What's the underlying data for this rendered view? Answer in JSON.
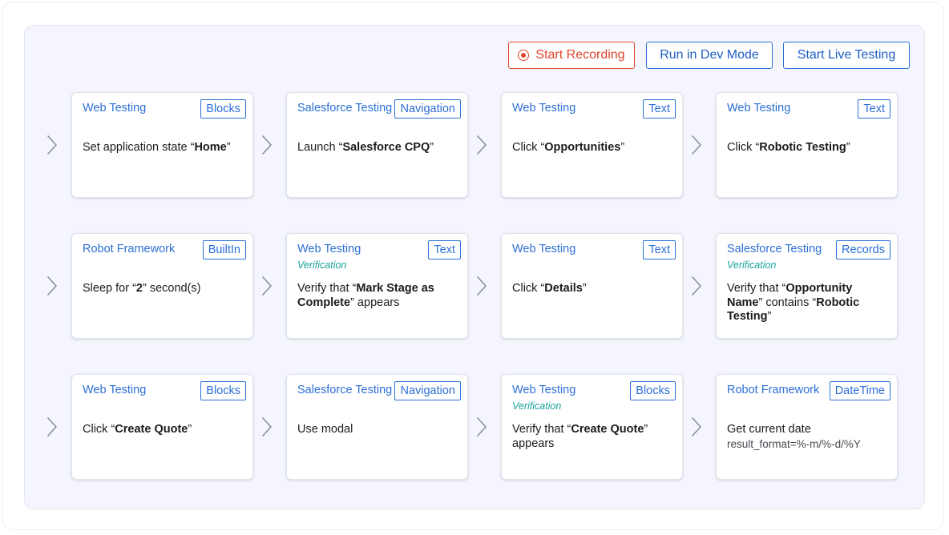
{
  "toolbar": {
    "start_recording": "Start Recording",
    "run_dev_mode": "Run in Dev Mode",
    "start_live_testing": "Start Live Testing"
  },
  "colors": {
    "accent_blue": "#2c6fd6",
    "record_red": "#e0452c",
    "verification_teal": "#1aa39a",
    "panel_bg": "#f5f6fd"
  },
  "icons": [
    "record-icon",
    "chevron-right-icon"
  ],
  "cards": [
    {
      "library": "Web Testing",
      "badge": "Blocks",
      "verification": "",
      "text_pre": "Set application state “",
      "text_bold": "Home",
      "text_post": "”",
      "param": ""
    },
    {
      "library": "Salesforce Testing",
      "badge": "Navigation",
      "verification": "",
      "text_pre": "Launch “",
      "text_bold": "Salesforce CPQ",
      "text_post": "”",
      "param": ""
    },
    {
      "library": "Web Testing",
      "badge": "Text",
      "verification": "",
      "text_pre": "Click “",
      "text_bold": "Opportunities",
      "text_post": "”",
      "param": ""
    },
    {
      "library": "Web Testing",
      "badge": "Text",
      "verification": "",
      "text_pre": "Click “",
      "text_bold": "Robotic Testing",
      "text_post": "”",
      "param": ""
    },
    {
      "library": "Robot Framework",
      "badge": "BuiltIn",
      "verification": "",
      "text_pre": "Sleep for “",
      "text_bold": "2",
      "text_post": "” second(s)",
      "param": ""
    },
    {
      "library": "Web Testing",
      "badge": "Text",
      "verification": "Verification",
      "text_pre": "Verify that “",
      "text_bold": "Mark Stage as Complete",
      "text_post": "” appears",
      "param": ""
    },
    {
      "library": "Web Testing",
      "badge": "Text",
      "verification": "",
      "text_pre": "Click “",
      "text_bold": "Details",
      "text_post": "”",
      "param": ""
    },
    {
      "library": "Salesforce Testing",
      "badge": "Records",
      "verification": "Verification",
      "text_pre": "Verify that “",
      "text_bold": "Opportunity Name",
      "text_post": "” contains “",
      "text_bold2": "Robotic Testing",
      "text_post2": "”",
      "param": ""
    },
    {
      "library": "Web Testing",
      "badge": "Blocks",
      "verification": "",
      "text_pre": "Click “",
      "text_bold": "Create Quote",
      "text_post": "”",
      "param": ""
    },
    {
      "library": "Salesforce Testing",
      "badge": "Navigation",
      "verification": "",
      "text_pre": "Use modal",
      "text_bold": "",
      "text_post": "",
      "param": ""
    },
    {
      "library": "Web Testing",
      "badge": "Blocks",
      "verification": "Verification",
      "text_pre": "Verify that “",
      "text_bold": "Create Quote",
      "text_post": "” appears",
      "param": ""
    },
    {
      "library": "Robot Framework",
      "badge": "DateTime",
      "verification": "",
      "text_pre": "Get current date",
      "text_bold": "",
      "text_post": "",
      "param": "result_format=%-m/%-d/%Y"
    }
  ]
}
